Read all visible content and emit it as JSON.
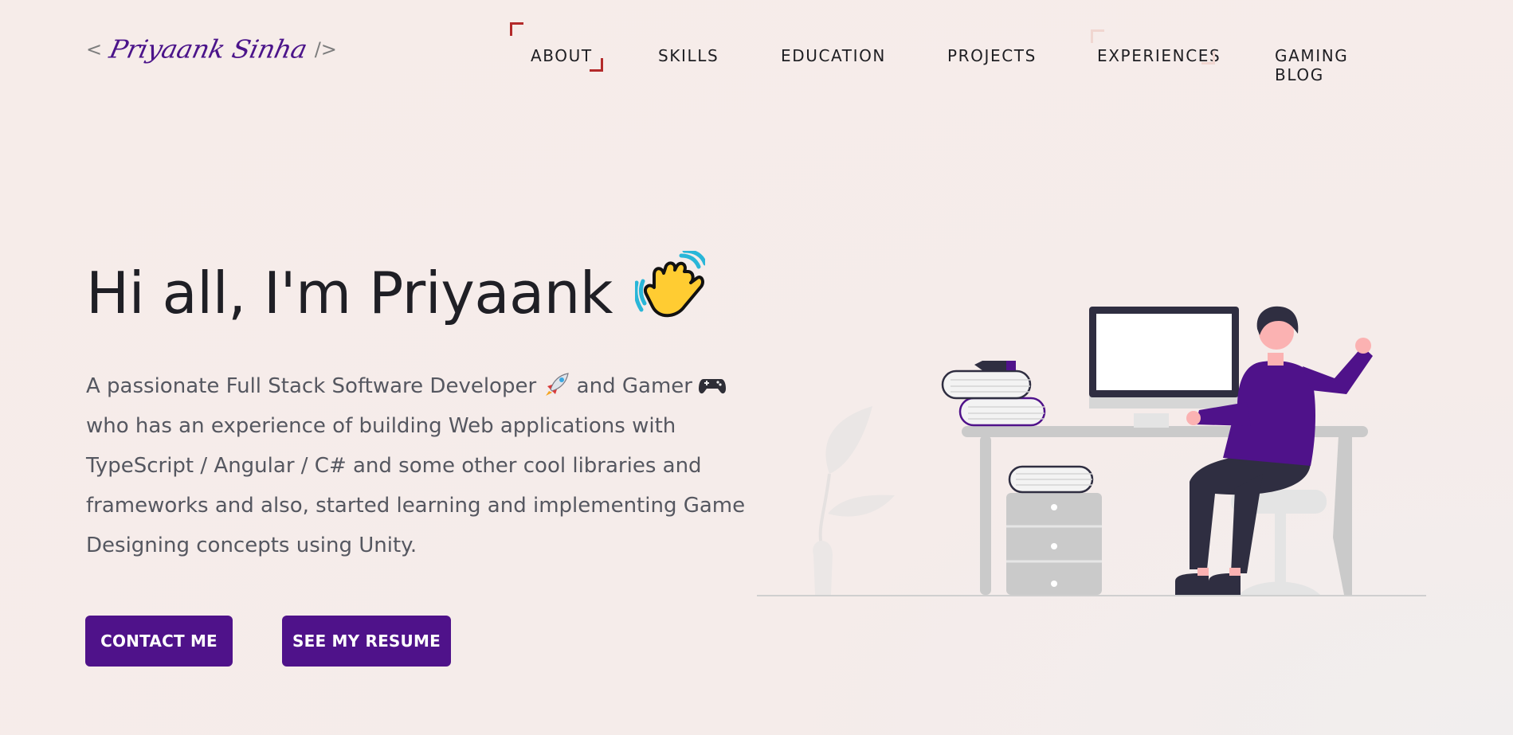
{
  "logo": {
    "open": "<",
    "name": "Priyaank Sinha",
    "close": "/>"
  },
  "nav": {
    "items": [
      {
        "label": "ABOUT"
      },
      {
        "label": "SKILLS"
      },
      {
        "label": "EDUCATION"
      },
      {
        "label": "PROJECTS"
      },
      {
        "label": "EXPERIENCES"
      },
      {
        "label": "GAMING BLOG"
      }
    ],
    "active": "ABOUT"
  },
  "hero": {
    "title": "Hi all, I'm Priyaank",
    "wave_emoji": "👋",
    "description_parts": {
      "p1": "A passionate Full Stack Software Developer ",
      "rocket": "🚀",
      "p2": " and Gamer ",
      "gamepad": "🎮",
      "p3": " who has an experience of building Web applications with TypeScript / Angular / C# and some other cool libraries and frameworks and also, started learning and implementing Game Designing concepts using Unity."
    }
  },
  "buttons": {
    "contact": "CONTACT ME",
    "resume": "SEE MY RESUME"
  },
  "colors": {
    "accent": "#4f128a",
    "nav_corner": "#b32a2a",
    "background": "#f6ece9",
    "illustration_purple": "#4f128a",
    "illustration_gray": "#cacaca",
    "illustration_dark": "#2f2e41"
  },
  "icons": {
    "wave": "waving-hand-icon",
    "rocket": "rocket-icon",
    "gamepad": "gamepad-icon"
  }
}
